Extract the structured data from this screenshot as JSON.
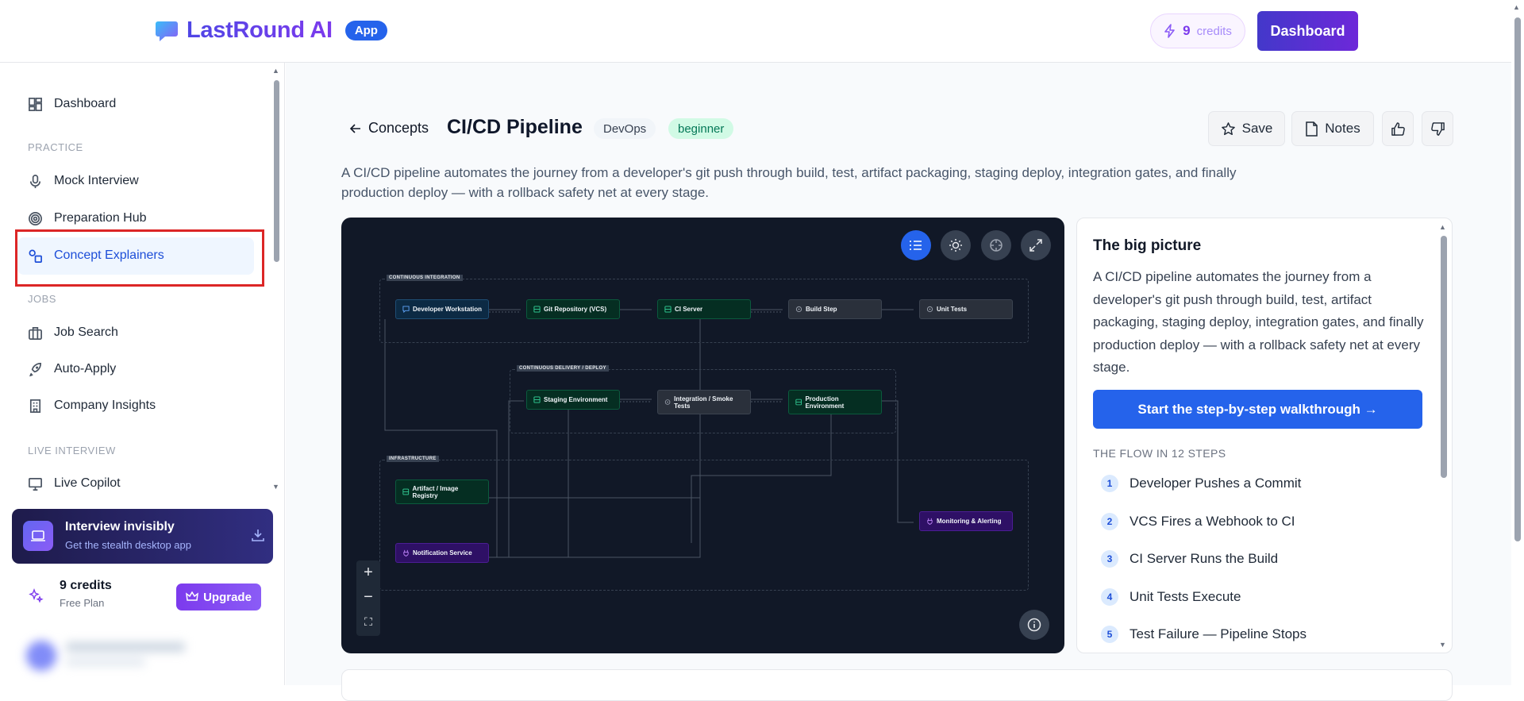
{
  "header": {
    "brand_name": "LastRound AI",
    "brand_badge": "App",
    "credits_count": "9",
    "credits_label": "credits",
    "dashboard_button": "Dashboard"
  },
  "sidebar": {
    "dashboard": "Dashboard",
    "section_practice": "PRACTICE",
    "mock_interview": "Mock Interview",
    "preparation_hub": "Preparation Hub",
    "concept_explainers": "Concept Explainers",
    "section_jobs": "JOBS",
    "job_search": "Job Search",
    "auto_apply": "Auto-Apply",
    "company_insights": "Company Insights",
    "section_live": "LIVE INTERVIEW",
    "live_copilot": "Live Copilot",
    "invisible_title": "Interview invisibly",
    "invisible_sub": "Get the stealth desktop app",
    "credits_text": "9 credits",
    "plan": "Free Plan",
    "upgrade": "Upgrade"
  },
  "concept": {
    "back": "Concepts",
    "title": "CI/CD Pipeline",
    "tag_category": "DevOps",
    "tag_level": "beginner",
    "save": "Save",
    "notes": "Notes",
    "description": "A CI/CD pipeline automates the journey from a developer's git push through build, test, artifact packaging, staging deploy, integration gates, and finally production deploy — with a rollback safety net at every stage."
  },
  "diagram": {
    "groups": {
      "ci": "CONTINUOUS INTEGRATION",
      "cd": "CONTINUOUS DELIVERY / DEPLOY",
      "infra": "INFRASTRUCTURE"
    },
    "nodes": {
      "dev": "Developer Workstation",
      "git": "Git Repository (VCS)",
      "ci": "CI Server",
      "build": "Build Step",
      "unit": "Unit Tests",
      "staging": "Staging Environment",
      "integration": "Integration / Smoke Tests",
      "prod": "Production Environment",
      "artifact": "Artifact / Image Registry",
      "notify": "Notification Service",
      "monitor": "Monitoring & Alerting"
    },
    "zoom_in": "+",
    "zoom_out": "−",
    "fit": "⛶"
  },
  "panel": {
    "title": "The big picture",
    "text": "A CI/CD pipeline automates the journey from a developer's git push through build, test, artifact packaging, staging deploy, integration gates, and finally production deploy — with a rollback safety net at every stage.",
    "walkthrough": "Start the step-by-step walkthrough →",
    "steps_heading": "THE FLOW IN 12 STEPS",
    "steps": [
      {
        "num": "1",
        "label": "Developer Pushes a Commit"
      },
      {
        "num": "2",
        "label": "VCS Fires a Webhook to CI"
      },
      {
        "num": "3",
        "label": "CI Server Runs the Build"
      },
      {
        "num": "4",
        "label": "Unit Tests Execute"
      },
      {
        "num": "5",
        "label": "Test Failure — Pipeline Stops"
      }
    ]
  },
  "colors": {
    "primary": "#2563eb",
    "brand_gradient_start": "#4f46e5",
    "brand_gradient_end": "#7c3aed",
    "diagram_bg": "#111827",
    "highlight": "#dc2626"
  }
}
